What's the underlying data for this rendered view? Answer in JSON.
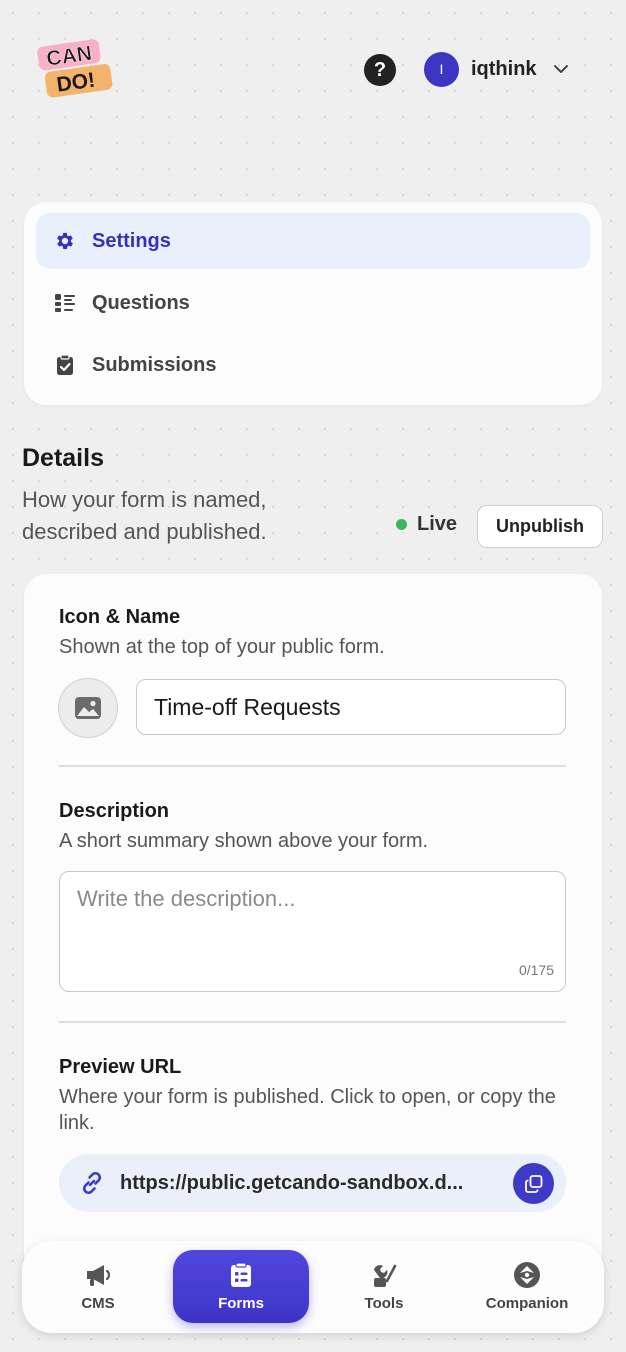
{
  "header": {
    "logo_text_top": "CAN",
    "logo_text_bottom": "DO!",
    "help_label": "?",
    "user": {
      "initial": "I",
      "name": "iqthink"
    }
  },
  "nav": {
    "items": [
      {
        "label": "Settings",
        "icon": "gear-icon",
        "active": true
      },
      {
        "label": "Questions",
        "icon": "list-icon",
        "active": false
      },
      {
        "label": "Submissions",
        "icon": "clipboard-check-icon",
        "active": false
      }
    ]
  },
  "details": {
    "title": "Details",
    "subtitle": "How your form is named, described and published.",
    "status": "Live",
    "unpublish_label": "Unpublish"
  },
  "form": {
    "icon_name": {
      "title": "Icon & Name",
      "help": "Shown at the top of your public form.",
      "name_value": "Time-off Requests"
    },
    "description": {
      "title": "Description",
      "help": "A short summary shown above your form.",
      "placeholder": "Write the description...",
      "counter": "0/175"
    },
    "preview_url": {
      "title": "Preview URL",
      "help": "Where your form is published. Click to open, or copy the link.",
      "url": "https://public.getcando-sandbox.d..."
    }
  },
  "bottom_nav": {
    "items": [
      {
        "label": "CMS",
        "icon": "megaphone-icon",
        "active": false
      },
      {
        "label": "Forms",
        "icon": "clipboard-list-icon",
        "active": true
      },
      {
        "label": "Tools",
        "icon": "tools-icon",
        "active": false
      },
      {
        "label": "Companion",
        "icon": "companion-icon",
        "active": false
      }
    ]
  },
  "colors": {
    "accent": "#3f39c8",
    "active_nav_bg": "#eaf0fb",
    "live_green": "#3db65b",
    "url_pill_bg": "#eaeffa"
  }
}
